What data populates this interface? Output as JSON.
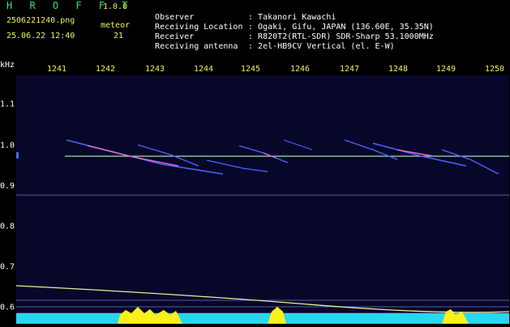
{
  "header": {
    "title": "H R O F F T",
    "version": "1.0.0",
    "filename": "2506221240.png",
    "meteor_label": "meteor",
    "datetime": "25.06.22 12:40",
    "meteor_count": "21"
  },
  "info": [
    {
      "key": "Observer",
      "value": "Takanori Kawachi"
    },
    {
      "key": "Receiving Location",
      "value": "Ogaki, Gifu, JAPAN (136.60E, 35.35N)"
    },
    {
      "key": "Receiver",
      "value": "R820T2(RTL-SDR) SDR-Sharp 53.1000MHz"
    },
    {
      "key": "Receiving antenna",
      "value": "2el-HB9CV Vertical (el. E-W)"
    }
  ],
  "axis": {
    "y_unit": "kHz",
    "x_ticks": [
      "1241",
      "1242",
      "1243",
      "1244",
      "1245",
      "1246",
      "1247",
      "1248",
      "1249",
      "1250"
    ],
    "y_ticks": [
      "1.1",
      "1.0",
      "0.9",
      "0.8",
      "0.7",
      "0.6"
    ]
  },
  "colors": {
    "grid_line": "#7d7dc8",
    "carrier": "#9fe39f",
    "trace": "#4a64ff",
    "trace_hot": "#ff6bd2",
    "drift": "#e3f09a",
    "level_cyan": "#27d7ee",
    "level_yellow": "#ffef1a"
  }
}
